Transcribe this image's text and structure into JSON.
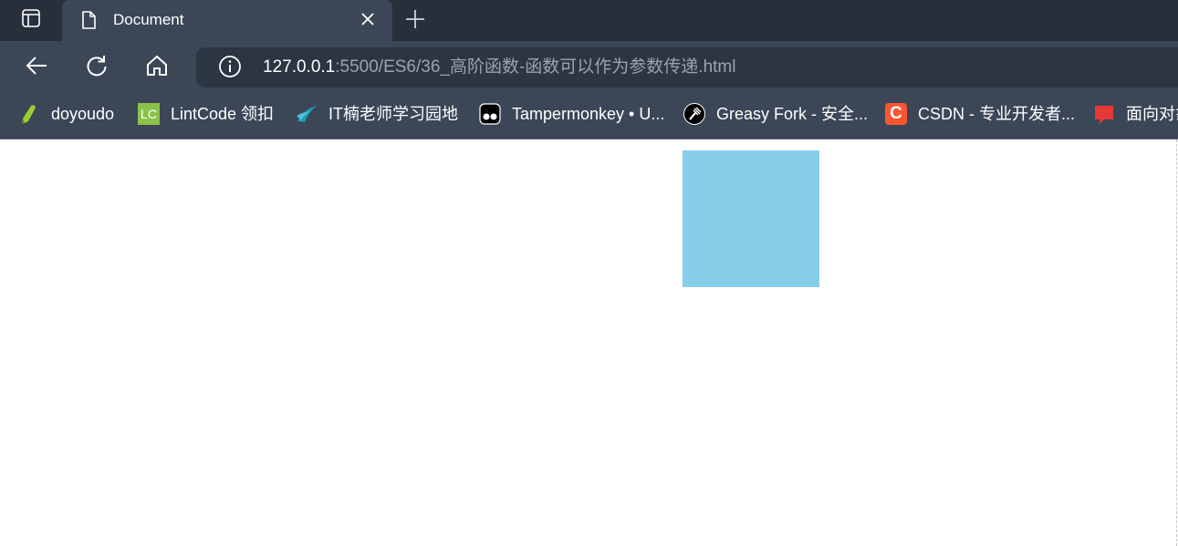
{
  "browser": {
    "tab": {
      "title": "Document",
      "icons": {
        "favicon": "page-icon",
        "close": "close-icon"
      }
    },
    "tab_actions_icon": "tab-actions-icon",
    "new_tab_icon": "plus-icon",
    "nav": {
      "back_icon": "back-arrow-icon",
      "refresh_icon": "refresh-icon",
      "home_icon": "home-icon"
    },
    "address": {
      "info_icon": "info-icon",
      "host": "127.0.0.1",
      "path": ":5500/ES6/36_高阶函数-函数可以作为参数传递.html"
    },
    "bookmarks": [
      {
        "label": "doyoudo",
        "icon": "doyoudo-icon"
      },
      {
        "label": "LintCode 领扣",
        "icon": "lintcode-icon",
        "icon_text": "LC"
      },
      {
        "label": "IT楠老师学习园地",
        "icon": "it-nan-icon"
      },
      {
        "label": "Tampermonkey • U...",
        "icon": "tampermonkey-icon"
      },
      {
        "label": "Greasy Fork - 安全...",
        "icon": "greasyfork-icon"
      },
      {
        "label": "CSDN - 专业开发者...",
        "icon": "csdn-icon",
        "icon_text": "C"
      },
      {
        "label": "面向对象",
        "icon": "red-bookmark-icon"
      }
    ]
  },
  "page": {
    "box_color": "#87ceeb"
  }
}
